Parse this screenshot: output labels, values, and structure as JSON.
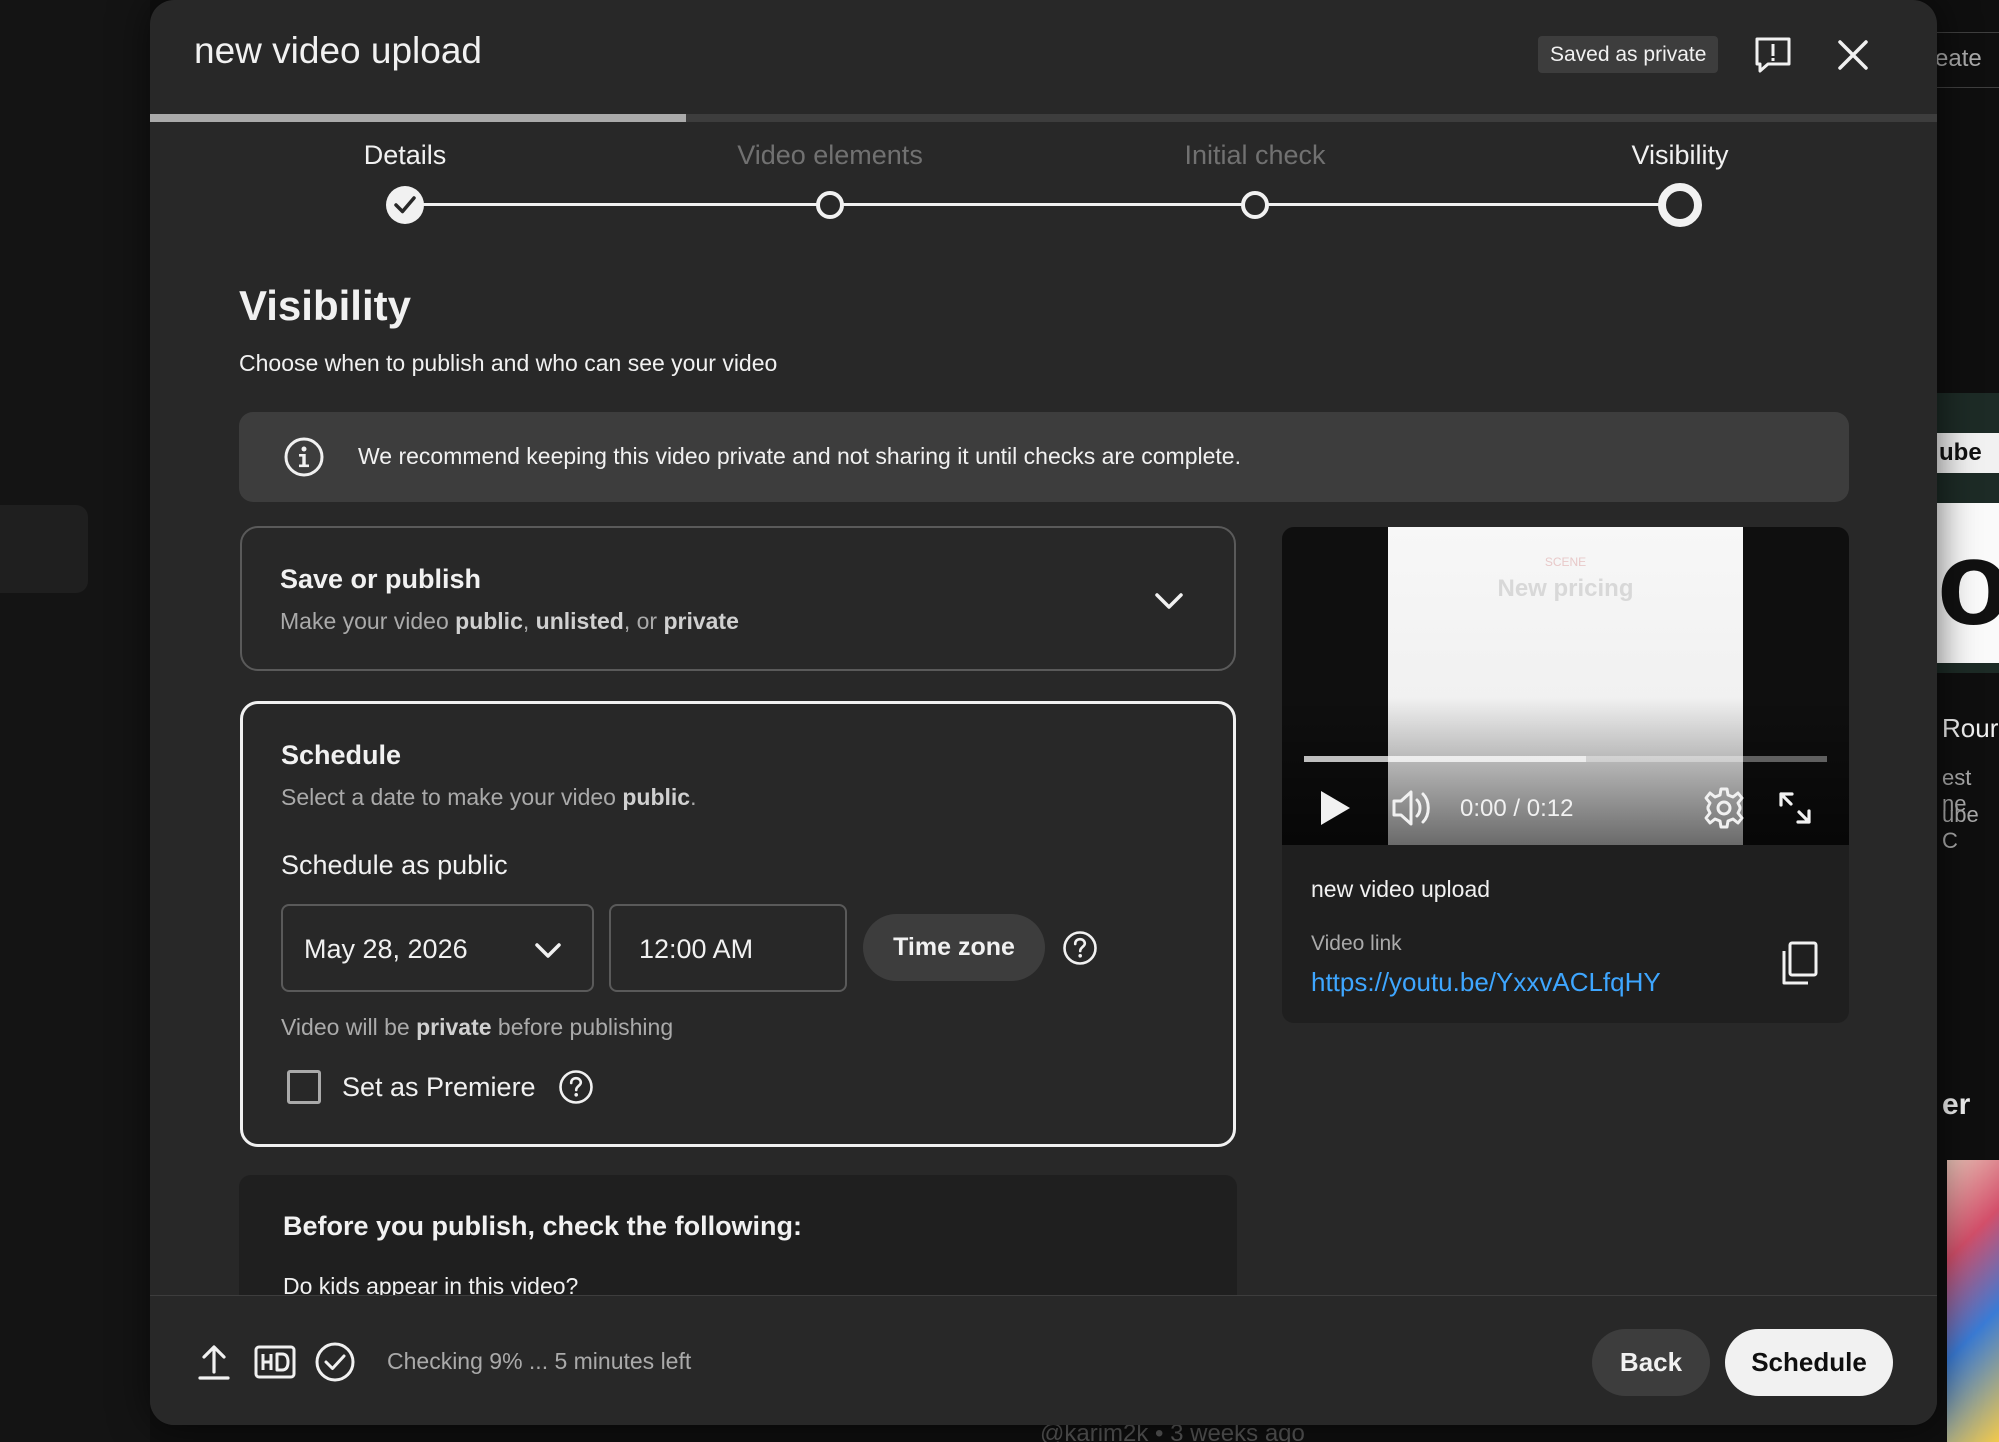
{
  "background": {
    "create_partial": "eate",
    "thumb_band_text": "ube",
    "thumb_big_text": "ou",
    "side_title_partial": "Rour",
    "side_line1": "est ne",
    "side_line2": "ube C",
    "side_heading_partial": "er",
    "bottom_comment": "@karim2k  • 3 weeks ago"
  },
  "dialog": {
    "title": "new video upload",
    "saved_badge": "Saved as private",
    "upload_progress": 0.3
  },
  "stepper": {
    "steps": [
      {
        "label": "Details",
        "state": "done"
      },
      {
        "label": "Video elements",
        "state": "todo"
      },
      {
        "label": "Initial check",
        "state": "todo"
      },
      {
        "label": "Visibility",
        "state": "current"
      }
    ]
  },
  "visibility": {
    "heading": "Visibility",
    "subheading": "Choose when to publish and who can see your video",
    "info_banner": "We recommend keeping this video private and not sharing it until checks are complete."
  },
  "save_publish": {
    "title": "Save or publish",
    "desc_prefix": "Make your video ",
    "opt_public": "public",
    "sep1": ", ",
    "opt_unlisted": "unlisted",
    "sep2": ", or ",
    "opt_private": "private"
  },
  "schedule": {
    "title": "Schedule",
    "desc_prefix": "Select a date to make your video ",
    "desc_bold": "public",
    "desc_suffix": ".",
    "label": "Schedule as public",
    "date_value": "May 28, 2026",
    "time_value": "12:00 AM",
    "timezone_button": "Time zone",
    "note_prefix": "Video will be ",
    "note_bold": "private",
    "note_suffix": " before publishing",
    "premiere_label": "Set as Premiere",
    "premiere_checked": false
  },
  "checklist": {
    "title": "Before you publish, check the following:",
    "question": "Do kids appear in this video?"
  },
  "preview": {
    "frame_small_text": "SCENE",
    "frame_big_text": "New pricing",
    "time_readout": "0:00 / 0:12",
    "buffered_fraction": 0.54,
    "video_title": "new video upload",
    "link_label": "Video link",
    "link_url": "https://youtu.be/YxxvACLfqHY"
  },
  "footer": {
    "status": "Checking 9% ... 5 minutes left",
    "back_button": "Back",
    "schedule_button": "Schedule"
  },
  "colors": {
    "dialog_bg": "#282828",
    "accent_link": "#3ea6ff",
    "primary_button_bg": "#f1f1f1"
  }
}
